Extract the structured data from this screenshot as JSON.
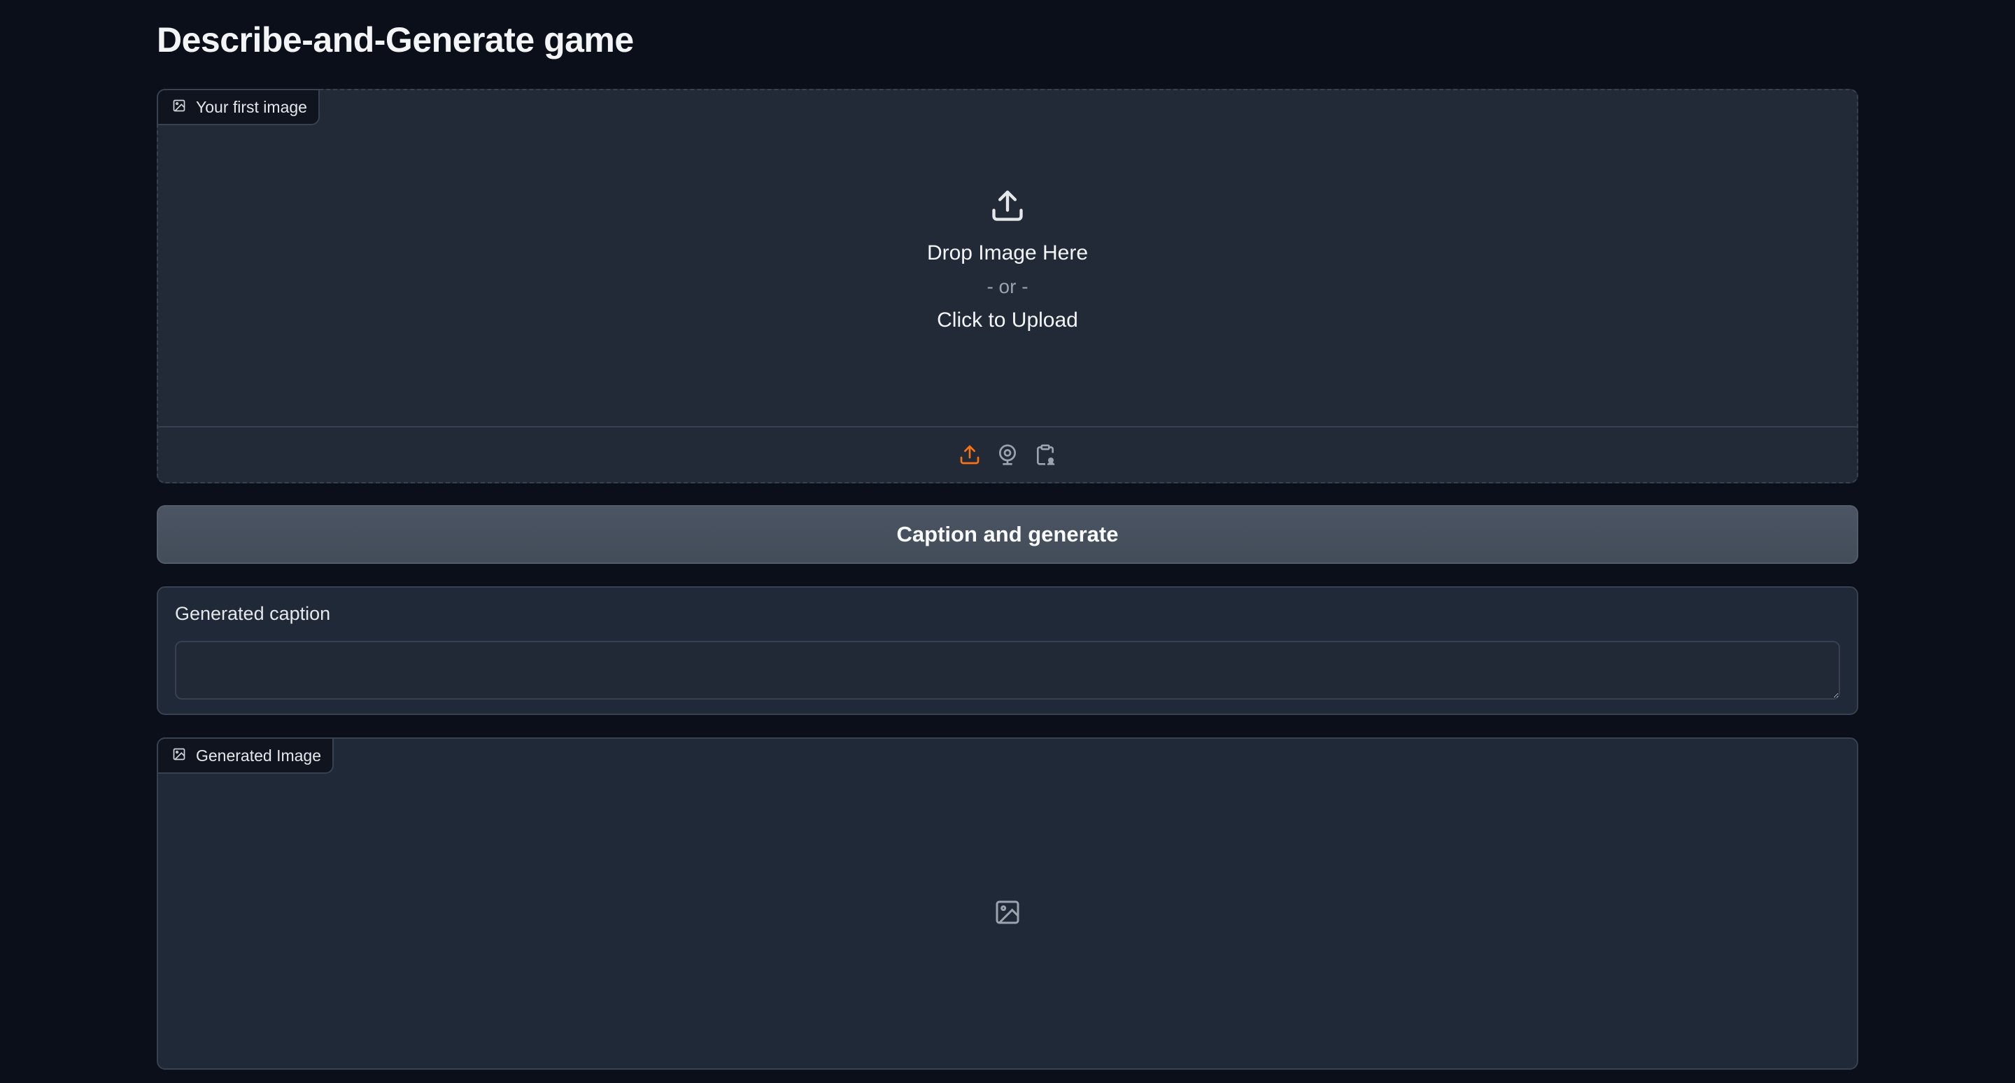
{
  "page": {
    "title": "Describe-and-Generate game"
  },
  "input_image": {
    "label": "Your first image",
    "drop_text": "Drop Image Here",
    "or_text": "- or -",
    "click_text": "Click to Upload",
    "sources": [
      "upload-icon",
      "webcam-icon",
      "clipboard-icon"
    ]
  },
  "action": {
    "button_label": "Caption and generate"
  },
  "caption": {
    "label": "Generated caption",
    "value": ""
  },
  "output_image": {
    "label": "Generated Image"
  },
  "colors": {
    "background": "#0b0f19",
    "panel": "#1f2937",
    "border": "#374151",
    "accent": "#f97316",
    "button": "#4b5563"
  }
}
